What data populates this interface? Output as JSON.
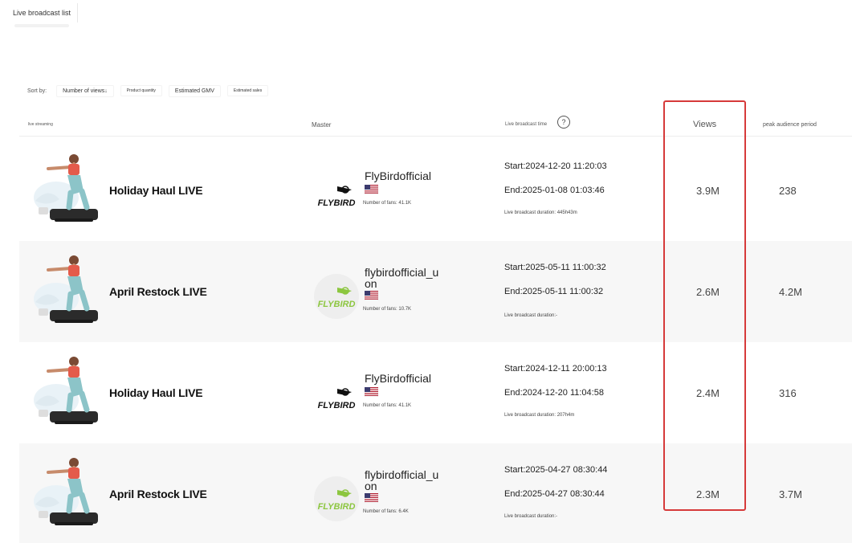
{
  "tab": {
    "label": "Live broadcast list"
  },
  "sort": {
    "label": "Sort by:",
    "options": [
      "Number of views↓",
      "Product quantity",
      "Estimated GMV",
      "Estimated sales"
    ]
  },
  "columns": {
    "stream": "live streaming",
    "master": "Master",
    "time": "Live broadcast time",
    "help": "?",
    "views": "Views",
    "peak": "peak audience period"
  },
  "rows": [
    {
      "title": "Holiday Haul LIVE",
      "logo_text": "FLYBIRD",
      "master_name": "FlyBirdofficial",
      "fans": "Number of fans: 41.1K",
      "start": "Start:2024-12-20 11:20:03",
      "end": "End:2025-01-08 01:03:46",
      "duration": "Live broadcast duration: 445h43m",
      "views": "3.9M",
      "peak": "238"
    },
    {
      "title": "April Restock LIVE",
      "logo_text": "FLYBIRD",
      "master_name": "flybirdofficial_u",
      "master_name_line2": "on",
      "fans": "Number of fans: 10.7K",
      "start": "Start:2025-05-11 11:00:32",
      "end": "End:2025-05-11 11:00:32",
      "duration": "Live broadcast duration:-",
      "views": "2.6M",
      "peak": "4.2M"
    },
    {
      "title": "Holiday Haul LIVE",
      "logo_text": "FLYBIRD",
      "master_name": "FlyBirdofficial",
      "fans": "Number of fans: 41.1K",
      "start": "Start:2024-12-11 20:00:13",
      "end": "End:2024-12-20 11:04:58",
      "duration": "Live broadcast duration: 207h4m",
      "views": "2.4M",
      "peak": "316"
    },
    {
      "title": "April Restock LIVE",
      "logo_text": "FLYBIRD",
      "master_name": "flybirdofficial_u",
      "master_name_line2": "on",
      "fans": "Number of fans: 6.4K",
      "start": "Start:2025-04-27 08:30:44",
      "end": "End:2025-04-27 08:30:44",
      "duration": "Live broadcast duration:-",
      "views": "2.3M",
      "peak": "3.7M"
    }
  ],
  "colors": {
    "highlight": "#d63a3a",
    "logo_black": "#111111",
    "logo_green": "#8cc63f"
  },
  "icons": [
    "help-circle-icon",
    "us-flag-icon",
    "flybird-logo",
    "product-thumbnail"
  ]
}
